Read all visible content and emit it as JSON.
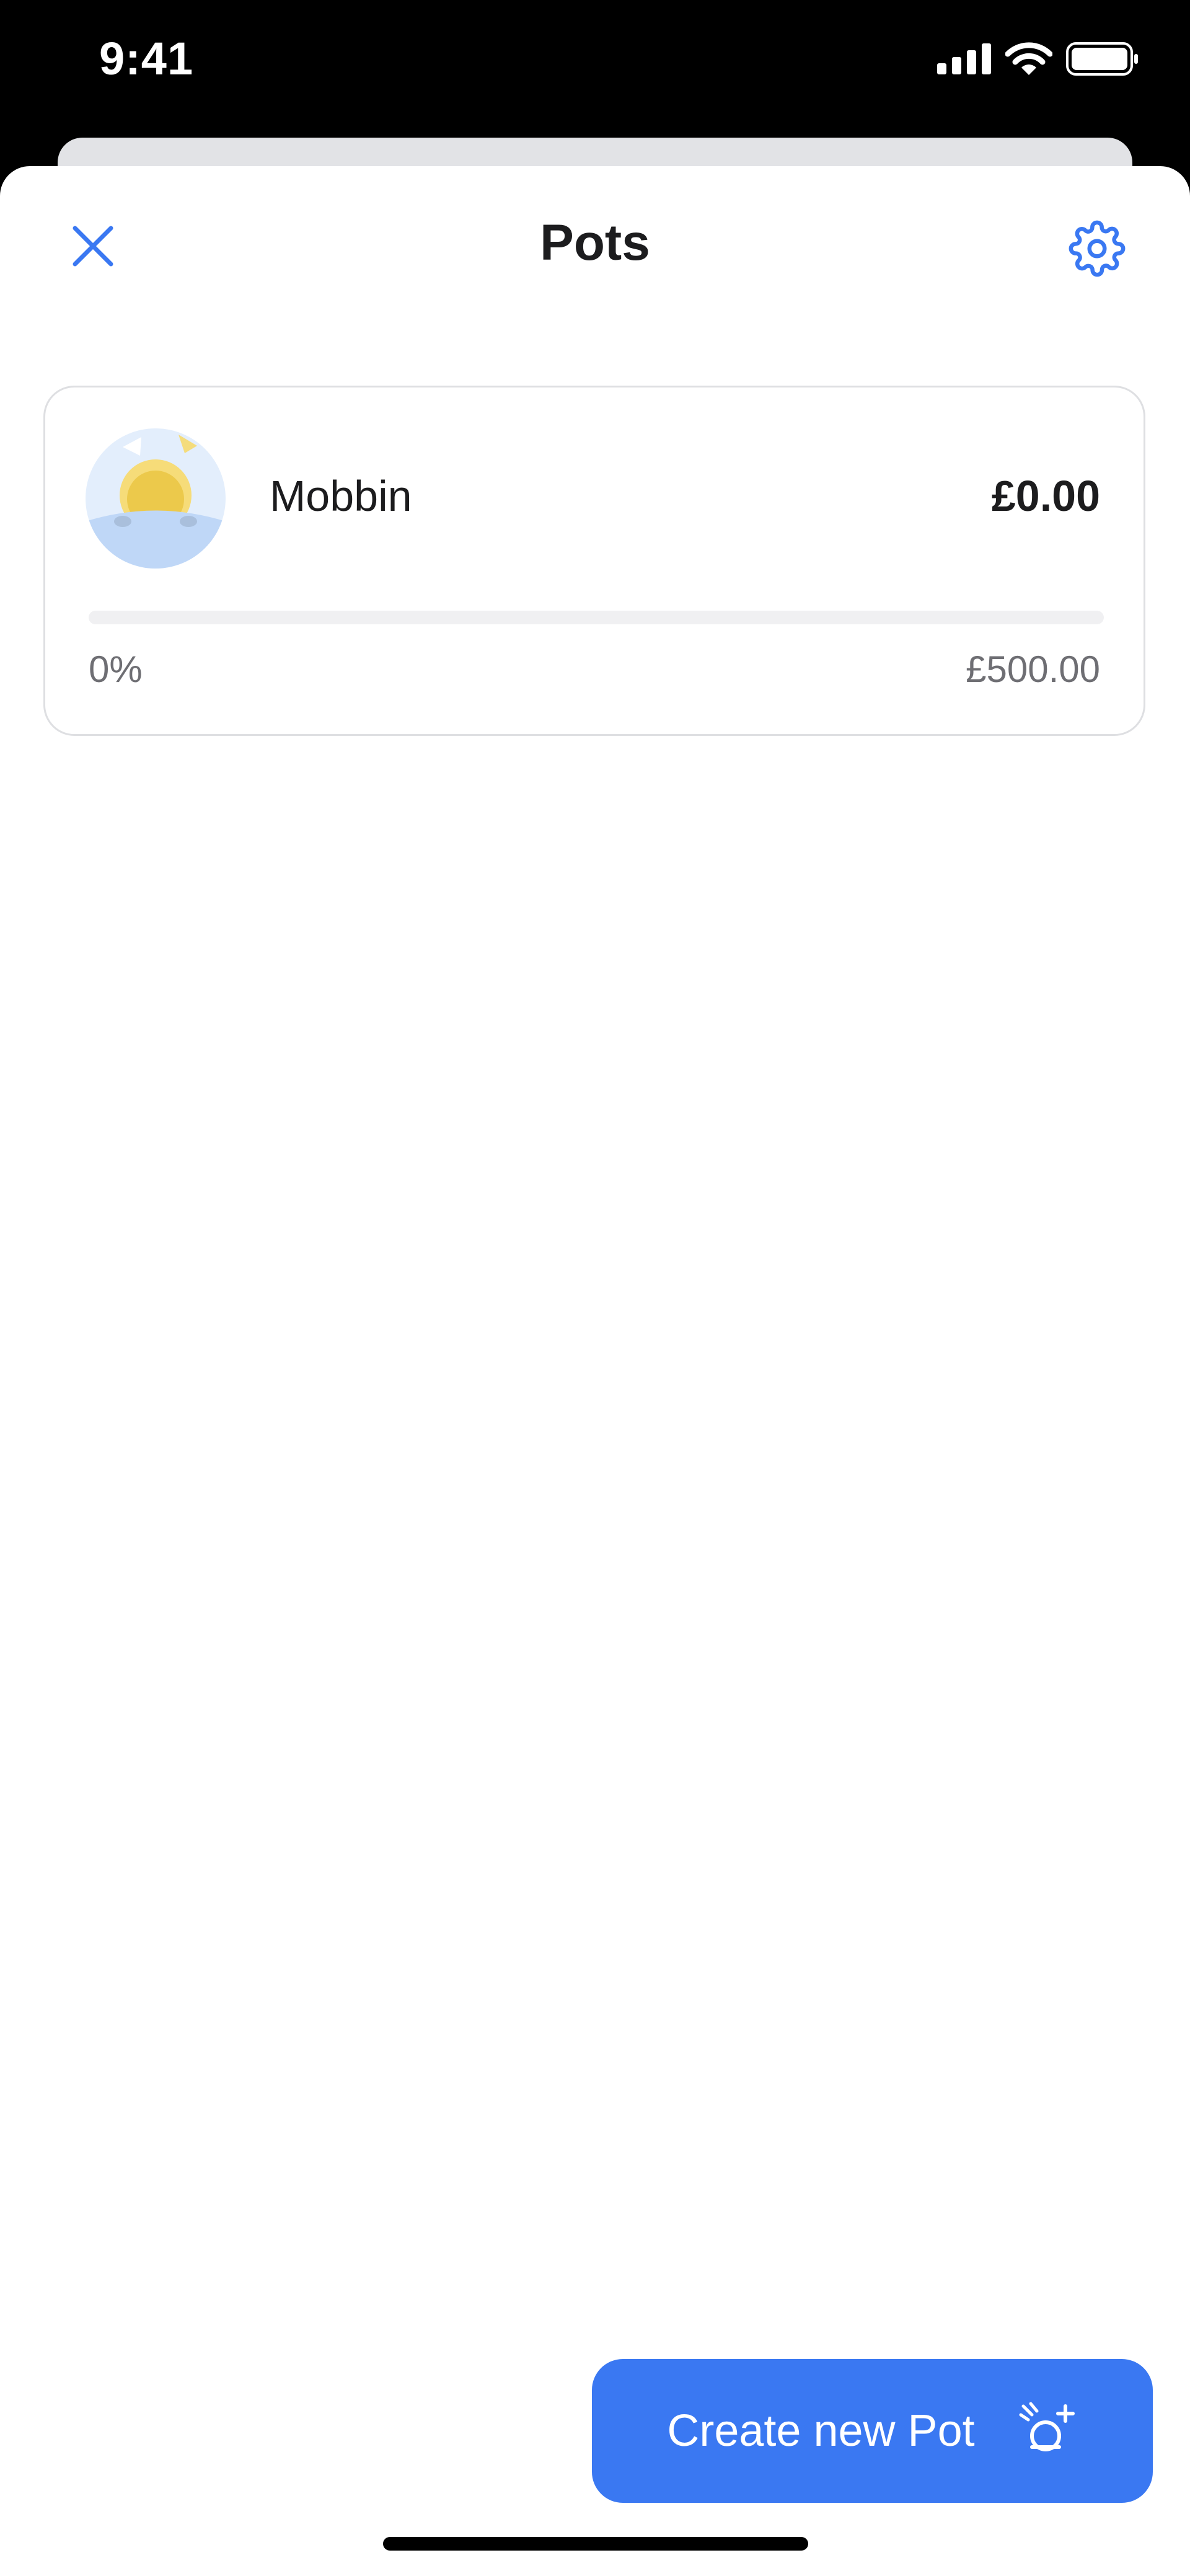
{
  "status_bar": {
    "time": "9:41",
    "icons": [
      "signal-icon",
      "wifi-icon",
      "battery-icon"
    ]
  },
  "header": {
    "title": "Pots",
    "close_icon": "close-icon",
    "settings_icon": "gear-icon"
  },
  "pots": [
    {
      "name": "Mobbin",
      "balance": "£0.00",
      "progress_label": "0%",
      "progress_fraction": 0,
      "goal": "£500.00",
      "icon": "sun-illustration"
    }
  ],
  "actions": {
    "create_label": "Create new Pot",
    "create_icon": "sparkle-pot-icon"
  },
  "colors": {
    "accent": "#3a78f2",
    "text": "#1c1c1e",
    "muted": "#6e6e73",
    "card_border": "#dedfe2"
  }
}
